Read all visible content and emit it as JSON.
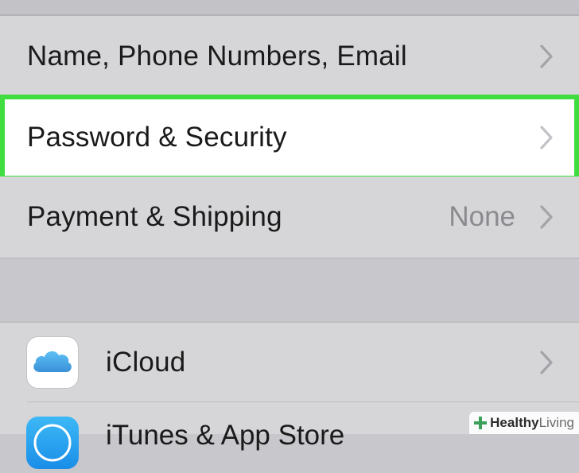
{
  "settings": {
    "rows": [
      {
        "label": "Name, Phone Numbers, Email",
        "detail": "",
        "icon": "chevron-right-icon"
      },
      {
        "label": "Password & Security",
        "detail": "",
        "icon": "chevron-right-icon",
        "highlighted": true
      },
      {
        "label": "Payment & Shipping",
        "detail": "None",
        "icon": "chevron-right-icon"
      }
    ],
    "services": [
      {
        "label": "iCloud",
        "icon": "icloud-icon"
      },
      {
        "label": "iTunes & App Store",
        "icon": "itunes-icon"
      }
    ]
  },
  "highlight_color": "#3fdd3f",
  "watermark": {
    "bold": "Healthy",
    "light": "Living"
  }
}
